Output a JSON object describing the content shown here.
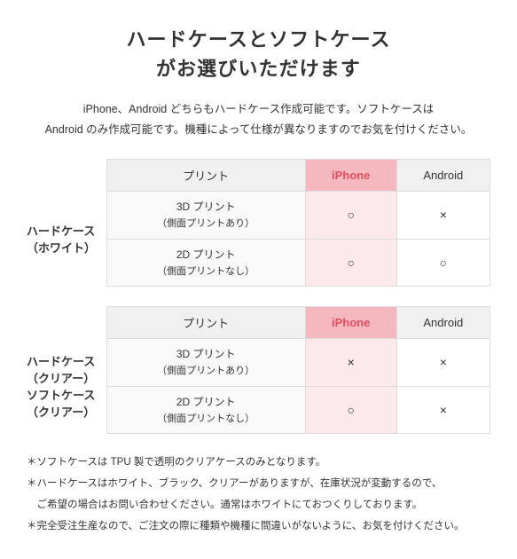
{
  "title": {
    "line1": "ハードケースとソフトケース",
    "line2": "がお選びいただけます"
  },
  "description": "iPhone、Android どちらもハードケース作成可能です。ソフトケースは\nAndroid のみ作成可能です。機種によって仕様が異なりますのでお気を付けください。",
  "table1": {
    "section_label_line1": "ハードケース",
    "section_label_line2": "（ホワイト）",
    "col_print": "プリント",
    "col_iphone": "iPhone",
    "col_android": "Android",
    "rows": [
      {
        "label_line1": "3D プリント",
        "label_line2": "（側面プリントあり）",
        "iphone": "○",
        "android": "×"
      },
      {
        "label_line1": "2D プリント",
        "label_line2": "（側面プリントなし）",
        "iphone": "○",
        "android": "○"
      }
    ]
  },
  "table2": {
    "section_label_line1": "ハードケース",
    "section_label_line2": "（クリアー）",
    "section_label2_line1": "ソフトケース",
    "section_label2_line2": "（クリアー）",
    "col_print": "プリント",
    "col_iphone": "iPhone",
    "col_android": "Android",
    "rows": [
      {
        "label_line1": "3D プリント",
        "label_line2": "（側面プリントあり）",
        "iphone": "×",
        "android": "×"
      },
      {
        "label_line1": "2D プリント",
        "label_line2": "（側面プリントなし）",
        "iphone": "○",
        "android": "×"
      }
    ]
  },
  "notes": [
    "＊ソフトケースは TPU 製で透明のクリアケースのみとなります。",
    "＊ハードケースはホワイト、ブラック、クリアーがありますが、在庫状況が変動するので、",
    "　ご希望の場合はお問い合わせください。通常はホワイトにておつくりしております。",
    "＊完全受注生産なので、ご注文の際に種類や機種に間違いがないように、お気を付けください。"
  ]
}
